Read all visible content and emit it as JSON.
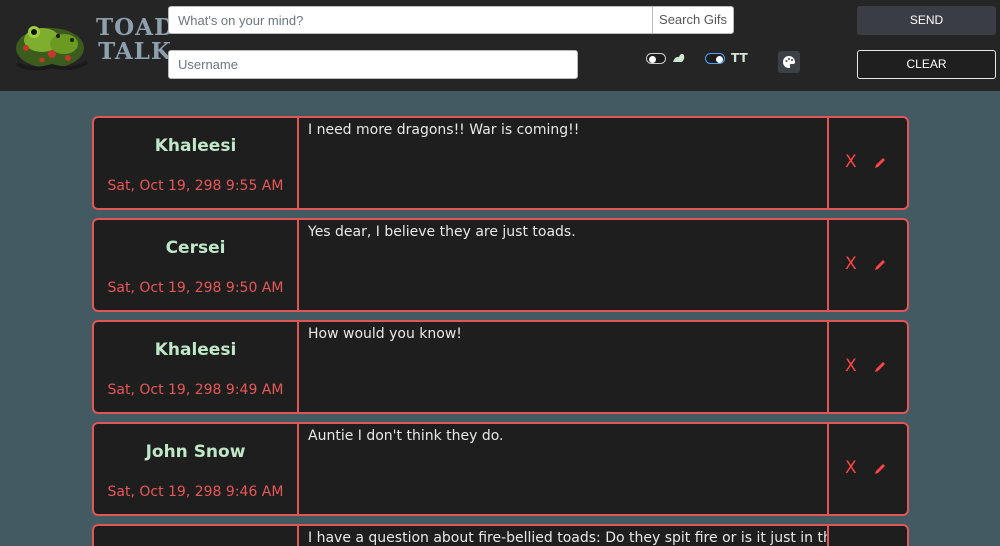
{
  "header": {
    "logo_text": "TOAD TALK",
    "message_placeholder": "What's on your mind?",
    "search_gifs_label": "Search Gifs",
    "username_placeholder": "Username",
    "send_label": "SEND",
    "clear_label": "CLEAR",
    "text_size_icon_label": "TT",
    "toggles": [
      {
        "name": "theme-toggle",
        "on": false
      },
      {
        "name": "text-size-toggle",
        "on": true
      }
    ]
  },
  "messages": [
    {
      "name": "Khaleesi",
      "time": "Sat, Oct 19, 298 9:55 AM",
      "text": "I need more dragons!! War is coming!!",
      "delete_label": "X"
    },
    {
      "name": "Cersei",
      "time": "Sat, Oct 19, 298 9:50 AM",
      "text": "Yes dear, I believe they are just toads.",
      "delete_label": "X"
    },
    {
      "name": "Khaleesi",
      "time": "Sat, Oct 19, 298 9:49 AM",
      "text": "How would you know!",
      "delete_label": "X"
    },
    {
      "name": "John Snow",
      "time": "Sat, Oct 19, 298 9:46 AM",
      "text": "Auntie I don't think they do.",
      "delete_label": "X"
    },
    {
      "name": "",
      "time": "",
      "text": "I have a question about fire-bellied toads: Do they spit fire or is it just in their",
      "delete_label": ""
    }
  ],
  "colors": {
    "background": "#435a63",
    "header": "#252525",
    "card": "#1e1e1e",
    "accent_red": "#e05555",
    "name_green": "#bfe8c8"
  }
}
